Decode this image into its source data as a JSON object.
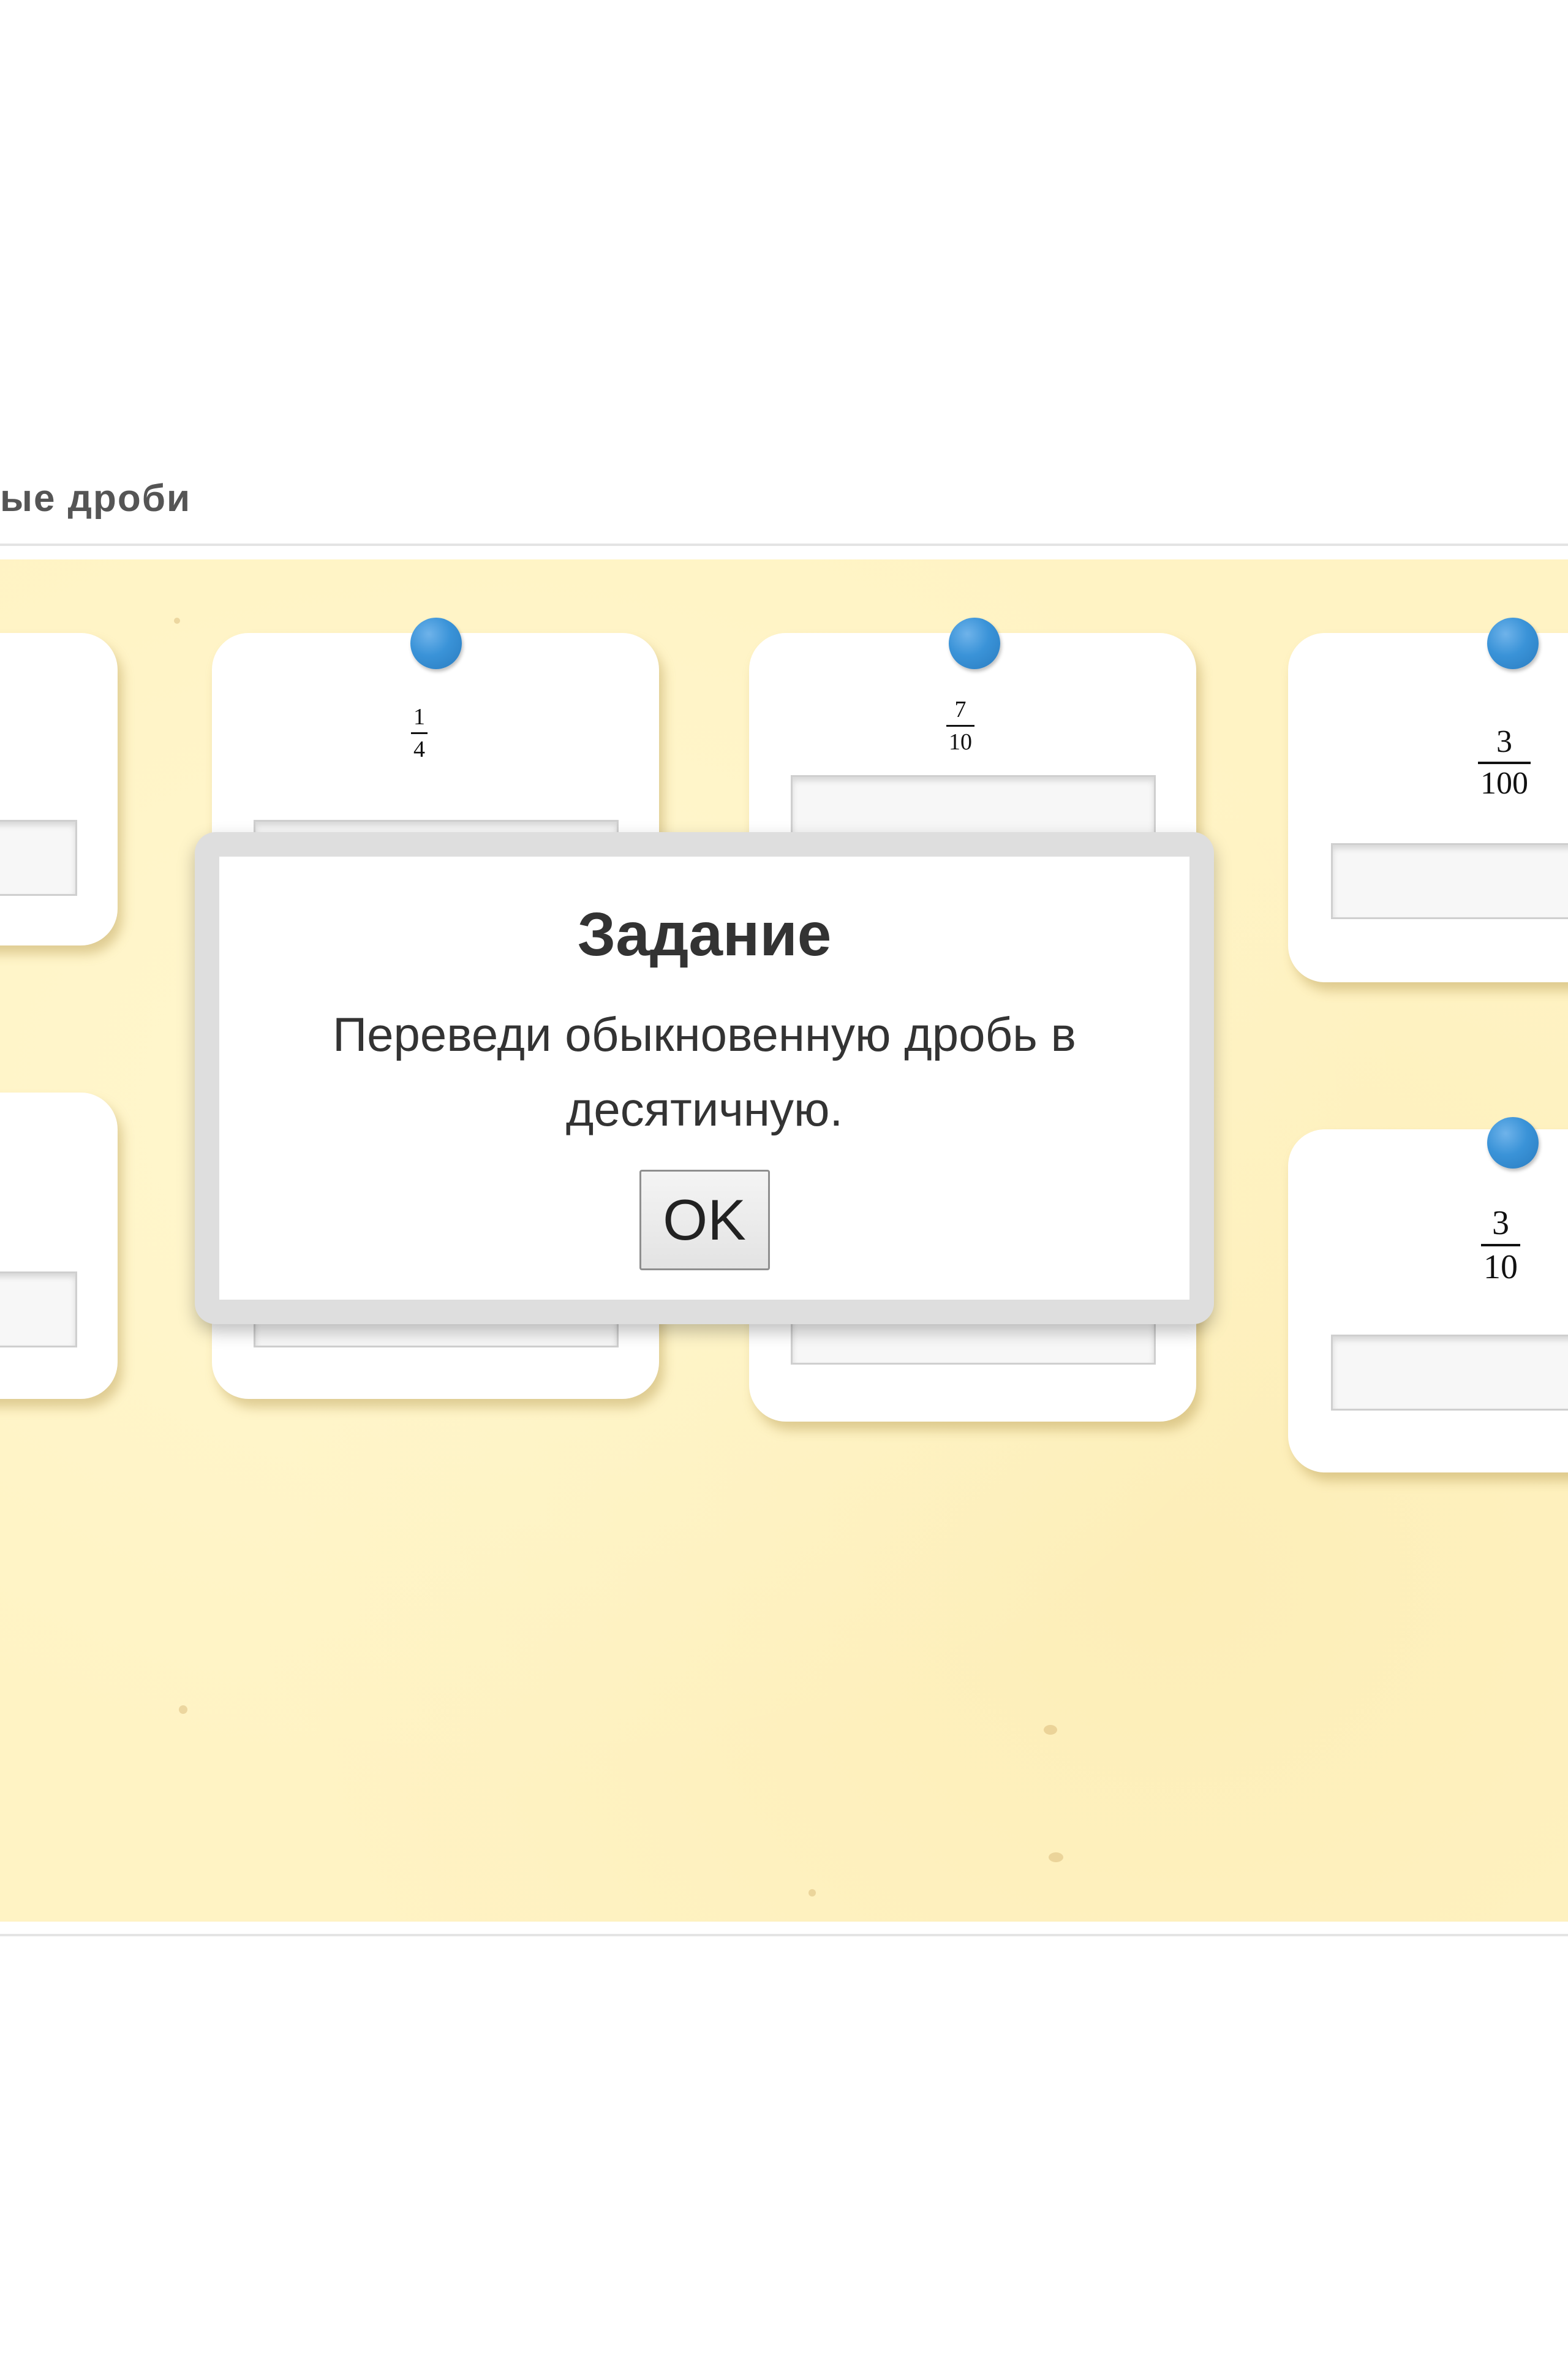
{
  "page": {
    "title": "ые дроби"
  },
  "modal": {
    "title": "Задание",
    "text": "Переведи обыкновенную дробь в десятичную.",
    "ok_label": "OK"
  },
  "cards": [
    {
      "numerator": "1",
      "denominator": "4"
    },
    {
      "numerator": "7",
      "denominator": "10"
    },
    {
      "numerator": "3",
      "denominator": "100"
    },
    {
      "numerator": "3",
      "denominator": "10"
    }
  ],
  "colors": {
    "pin": "#3a93d8",
    "board": "#fff3c4",
    "card": "#ffffff"
  },
  "icons": {
    "pin": "pin-icon"
  }
}
